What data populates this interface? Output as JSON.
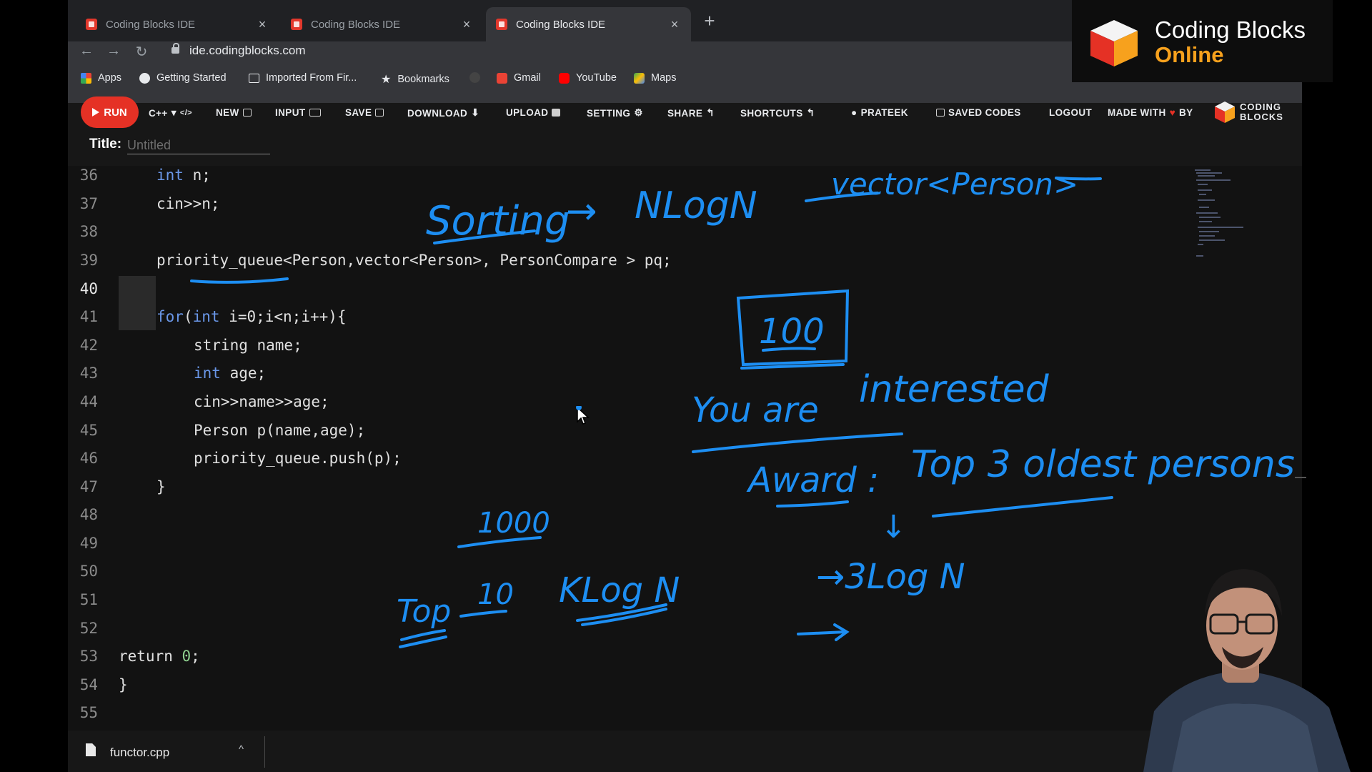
{
  "browser": {
    "tabs": [
      {
        "title": "Coding Blocks IDE",
        "active": false
      },
      {
        "title": "Coding Blocks IDE",
        "active": false
      },
      {
        "title": "Coding Blocks IDE",
        "active": true
      }
    ],
    "url": "ide.codingblocks.com",
    "bookmarks": [
      "Apps",
      "Getting Started",
      "Imported From Fir...",
      "Bookmarks",
      "Gmail",
      "YouTube",
      "Maps"
    ]
  },
  "ide": {
    "run_label": "RUN",
    "menu": {
      "lang": "C++",
      "new": "NEW",
      "input": "INPUT",
      "save": "SAVE",
      "download": "DOWNLOAD",
      "upload": "UPLOAD",
      "setting": "SETTING",
      "share": "SHARE",
      "shortcuts": "SHORTCUTS",
      "user": "PRATEEK",
      "saved_codes": "SAVED CODES",
      "logout": "LOGOUT",
      "made_with": "MADE WITH",
      "by": "BY"
    },
    "logo_text_line1": "CODING",
    "logo_text_line2": "BLOCKS",
    "title_label": "Title:",
    "title_placeholder": "Untitled",
    "line_numbers": [
      "36",
      "37",
      "38",
      "39",
      "40",
      "41",
      "42",
      "43",
      "44",
      "45",
      "46",
      "47",
      "48",
      "49",
      "50",
      "51",
      "52",
      "53",
      "54",
      "55"
    ],
    "current_line": "40",
    "code": {
      "l36_type": "int",
      "l36_rest": " n;",
      "l37": "cin>>n;",
      "l39": "priority_queue<Person,vector<Person>, PersonCompare > pq;",
      "l41_kw": "for",
      "l41_a": "(",
      "l41_kw2": "int",
      "l41_b": " i=0;i<n;i++){",
      "l42": "string name;",
      "l43_type": "int",
      "l43_rest": " age;",
      "l44": "cin>>name>>age;",
      "l45": "Person p(name,age);",
      "l46": "priority_queue.push(p);",
      "l47": "}",
      "l53_kw": "return",
      "l53_num": "0",
      "l53_end": ";",
      "l54": "}"
    },
    "file_tab": "functor.cpp"
  },
  "brand": {
    "title": "Coding Blocks",
    "subtitle": "Online"
  },
  "annotations": {
    "sorting": "Sorting",
    "arrow1": "→",
    "nlogn": "NLogN",
    "vector_person": "vector<Person>",
    "box_value": "100",
    "you_are": "You are",
    "interested": "interested",
    "award": "Award :",
    "top3": "Top 3 oldest persons",
    "down_arrow": "↓",
    "three_logn": "→3Log N",
    "thousand": "1000",
    "top": "Top",
    "ten": "10",
    "klogn": "KLog N",
    "arrow_last": "→"
  },
  "colors": {
    "ink": "#1d8ef2",
    "run_button": "#e53125",
    "brand_orange": "#f7a11d",
    "keyword": "#6a97e8",
    "number": "#8fd18f"
  }
}
